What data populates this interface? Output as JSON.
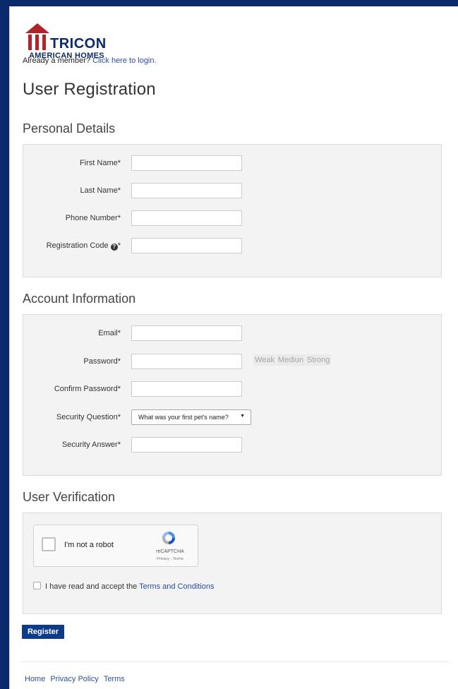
{
  "brand": {
    "name": "TRICON",
    "tagline": "AMERICAN HOMES",
    "accent_color": "#0b2a6b",
    "logo_red": "#b3232b"
  },
  "login": {
    "prefix": "Already a member?",
    "link": "Click here to login."
  },
  "page_title": "User Registration",
  "sections": {
    "personal": "Personal Details",
    "account": "Account Information",
    "verification": "User Verification"
  },
  "personal_fields": {
    "first_name": "First Name*",
    "last_name": "Last Name*",
    "phone": "Phone Number*",
    "registration_code": "Registration Code",
    "registration_code_suffix": "*"
  },
  "account_fields": {
    "email": "Email*",
    "password": "Password*",
    "confirm_password": "Confirm Password*",
    "security_question": "Security Question*",
    "security_question_value": "What was your first pet's name?",
    "security_answer": "Security Answer*"
  },
  "strength": {
    "weak": "Weak",
    "medium": "Mediun",
    "strong": "Strong"
  },
  "captcha": {
    "label": "I'm not a robot",
    "brand": "reCAPTCHA",
    "links": "Privacy - Terms"
  },
  "terms": {
    "prefix": "I have read and accept the",
    "link": "Terms and Conditions"
  },
  "register_label": "Register",
  "footer": [
    "Home",
    "Privacy Policy",
    "Terms"
  ]
}
